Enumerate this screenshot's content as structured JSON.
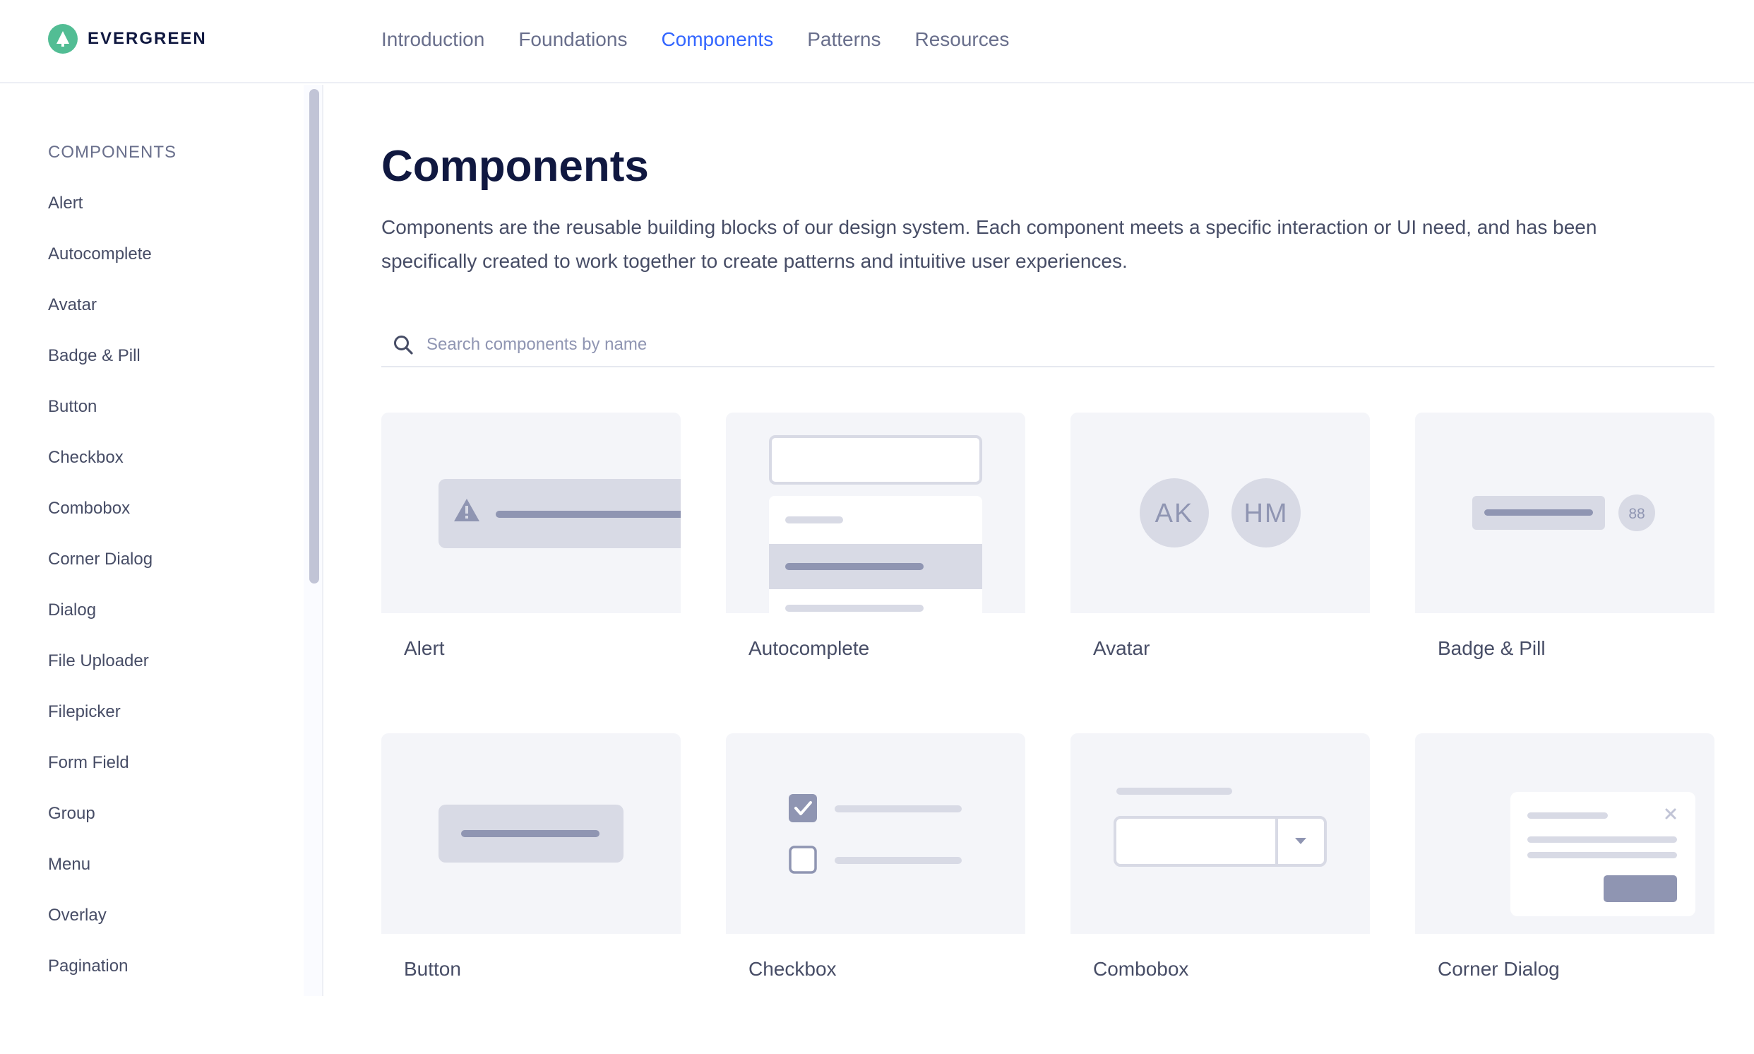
{
  "brand": {
    "name": "EVERGREEN",
    "logo_icon": "evergreen-tree-icon",
    "logo_color": "#52bd94"
  },
  "nav": {
    "items": [
      {
        "label": "Introduction",
        "active": false
      },
      {
        "label": "Foundations",
        "active": false
      },
      {
        "label": "Components",
        "active": true
      },
      {
        "label": "Patterns",
        "active": false
      },
      {
        "label": "Resources",
        "active": false
      }
    ],
    "active_color": "#3366ff"
  },
  "sidebar": {
    "heading": "COMPONENTS",
    "items": [
      "Alert",
      "Autocomplete",
      "Avatar",
      "Badge & Pill",
      "Button",
      "Checkbox",
      "Combobox",
      "Corner Dialog",
      "Dialog",
      "File Uploader",
      "Filepicker",
      "Form Field",
      "Group",
      "Menu",
      "Overlay",
      "Pagination"
    ]
  },
  "main": {
    "title": "Components",
    "description": "Components are the reusable building blocks of our design system. Each component meets a specific interaction or UI need, and has been specifically created to work together to create patterns and intuitive user experiences.",
    "search": {
      "placeholder": "Search components by name",
      "value": "",
      "icon": "search-icon"
    },
    "cards": [
      {
        "label": "Alert",
        "illustration": "alert"
      },
      {
        "label": "Autocomplete",
        "illustration": "autocomplete"
      },
      {
        "label": "Avatar",
        "illustration": "avatar",
        "avatars": [
          "AK",
          "HM"
        ]
      },
      {
        "label": "Badge & Pill",
        "illustration": "badge-pill",
        "pill_count": "88"
      },
      {
        "label": "Button",
        "illustration": "button"
      },
      {
        "label": "Checkbox",
        "illustration": "checkbox"
      },
      {
        "label": "Combobox",
        "illustration": "combobox"
      },
      {
        "label": "Corner Dialog",
        "illustration": "corner-dialog"
      }
    ]
  }
}
